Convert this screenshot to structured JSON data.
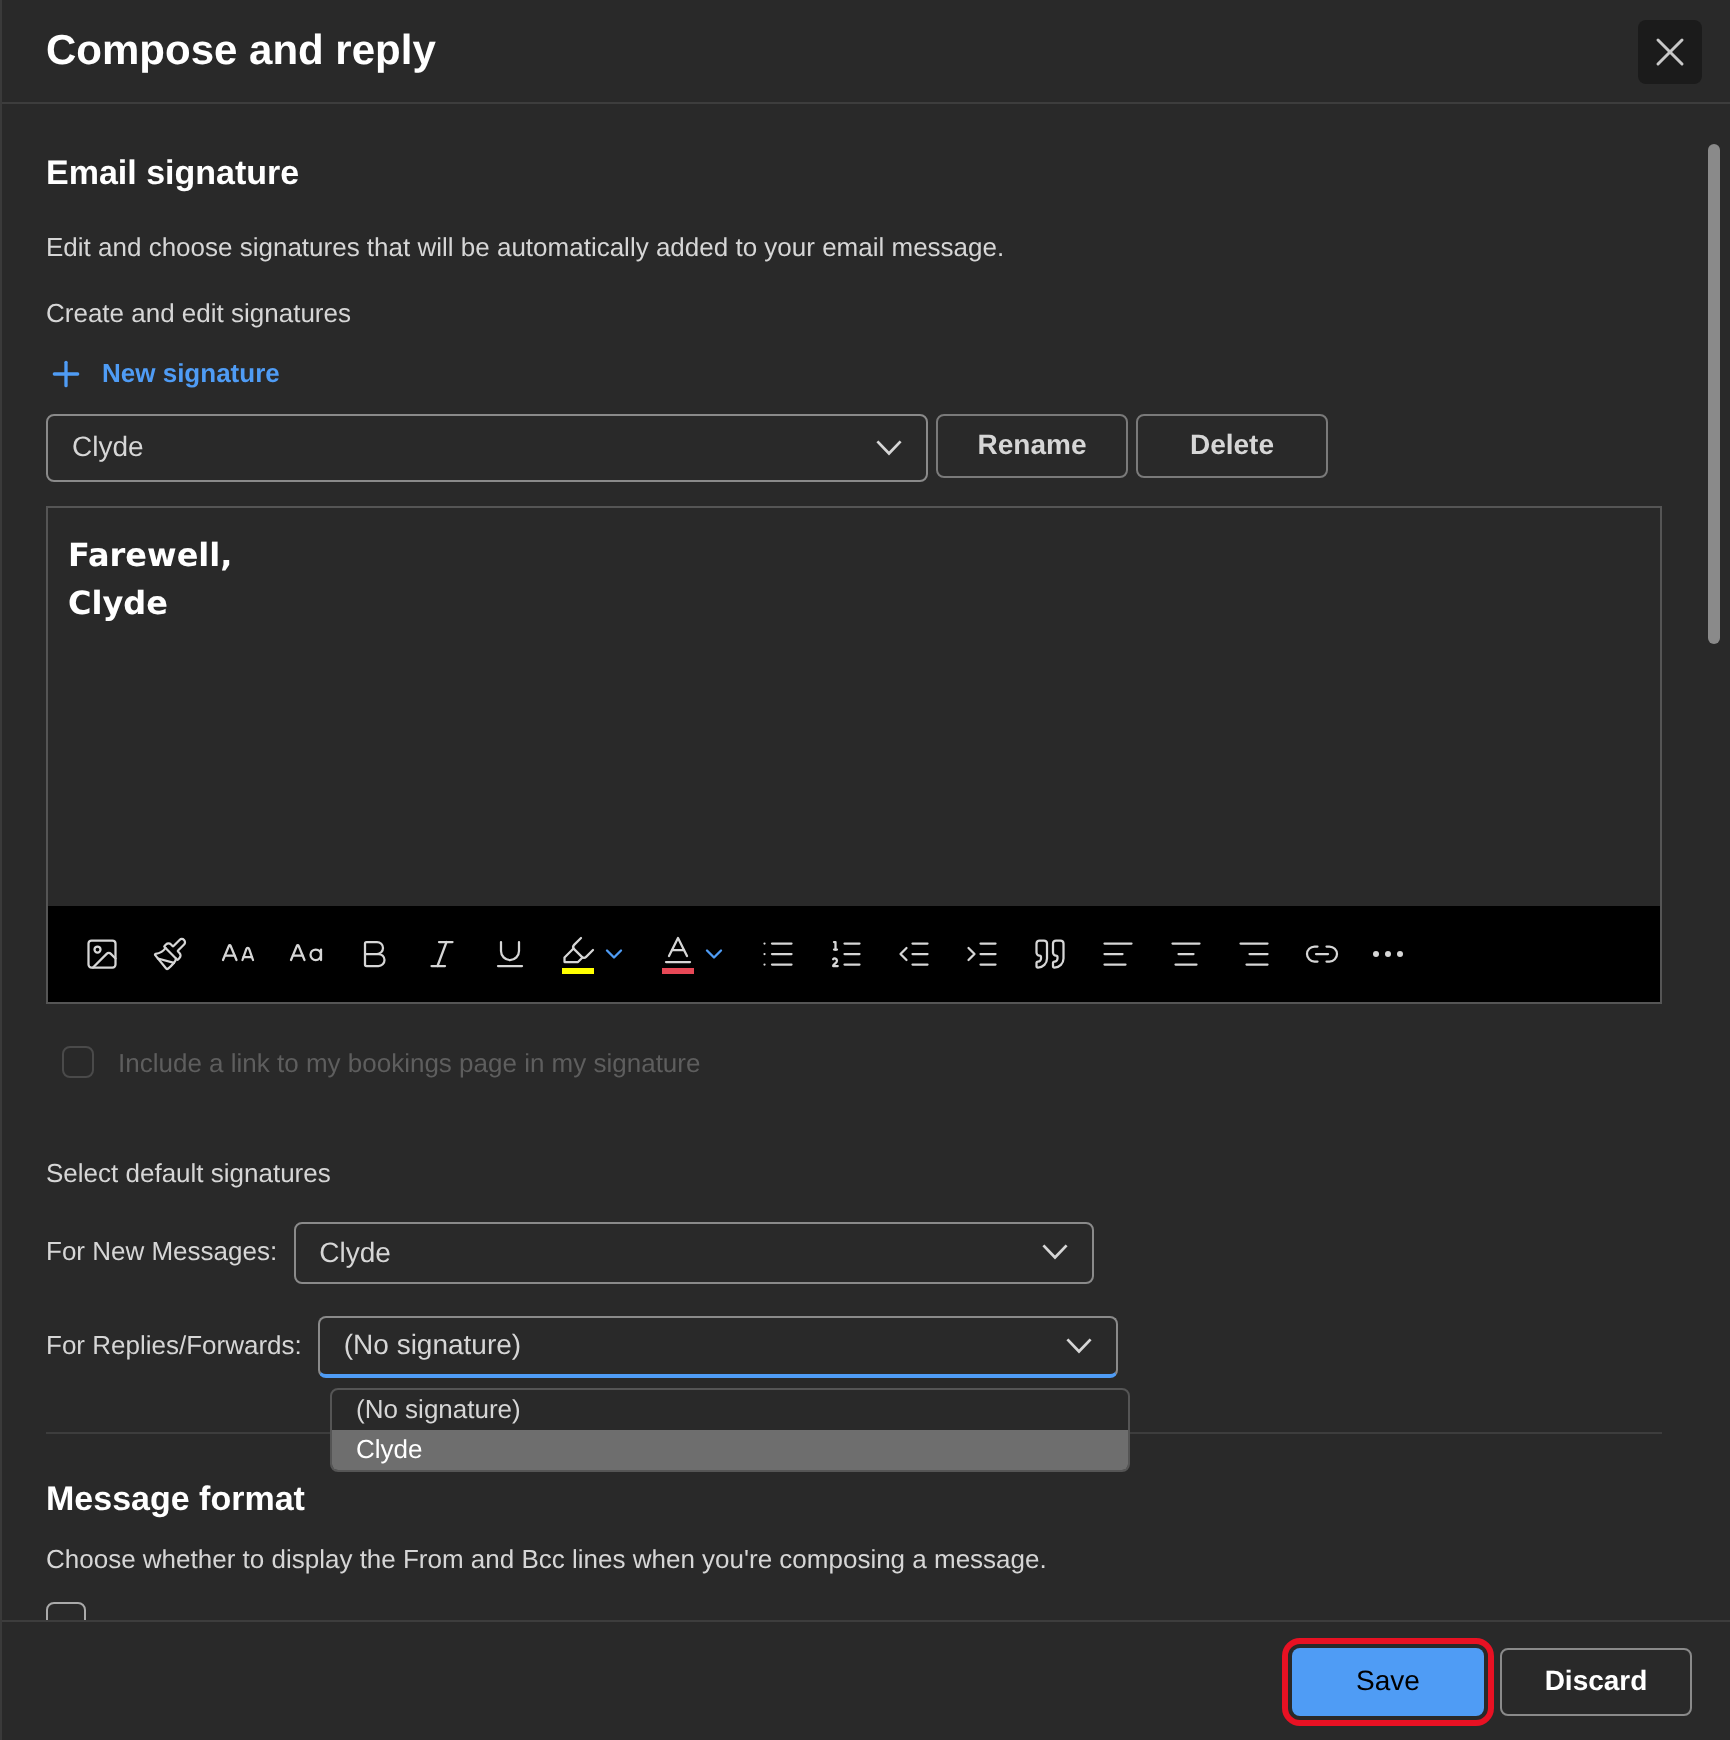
{
  "dialog": {
    "title": "Compose and reply"
  },
  "signature": {
    "heading": "Email signature",
    "description": "Edit and choose signatures that will be automatically added to your email message.",
    "create_label": "Create and edit signatures",
    "new_button": "New signature",
    "selected_signature": "Clyde",
    "buttons": [
      "Rename",
      "Delete"
    ],
    "body_lines": [
      "Farewell,",
      "Clyde"
    ],
    "toolbar": [
      {
        "kind": "image"
      },
      {
        "kind": "painter"
      },
      {
        "kind": "font-size"
      },
      {
        "kind": "grow"
      },
      {
        "kind": "bold"
      },
      {
        "kind": "italic"
      },
      {
        "kind": "underline"
      },
      {
        "kind": "highlight",
        "color": "#ffff00"
      },
      {
        "kind": "font-color",
        "color": "#e74856"
      },
      {
        "kind": "bullets"
      },
      {
        "kind": "numbering"
      },
      {
        "kind": "outdent"
      },
      {
        "kind": "indent"
      },
      {
        "kind": "quote"
      },
      {
        "kind": "align-left"
      },
      {
        "kind": "align-center"
      },
      {
        "kind": "align-right"
      },
      {
        "kind": "link"
      },
      {
        "kind": "more"
      }
    ],
    "bookings": {
      "label": "Include a link to my bookings page in my signature",
      "checked": false,
      "disabled": true
    }
  },
  "defaults": {
    "heading": "Select default signatures",
    "fields": [
      {
        "label": "For New Messages:",
        "value": "Clyde",
        "open": false
      },
      {
        "label": "For Replies/Forwards:",
        "value": "(No signature)",
        "open": true
      }
    ],
    "options": [
      {
        "label": "(No signature)",
        "selected": false
      },
      {
        "label": "Clyde",
        "selected": true
      }
    ]
  },
  "message_format": {
    "heading": "Message format",
    "description": "Choose whether to display the From and Bcc lines when you're composing a message.",
    "checkbox": {
      "checked": false
    }
  },
  "footer": {
    "buttons": [
      {
        "label": "Save",
        "kind": "primary",
        "highlighted": true
      },
      {
        "label": "Discard",
        "kind": "secondary",
        "highlighted": false
      }
    ]
  }
}
